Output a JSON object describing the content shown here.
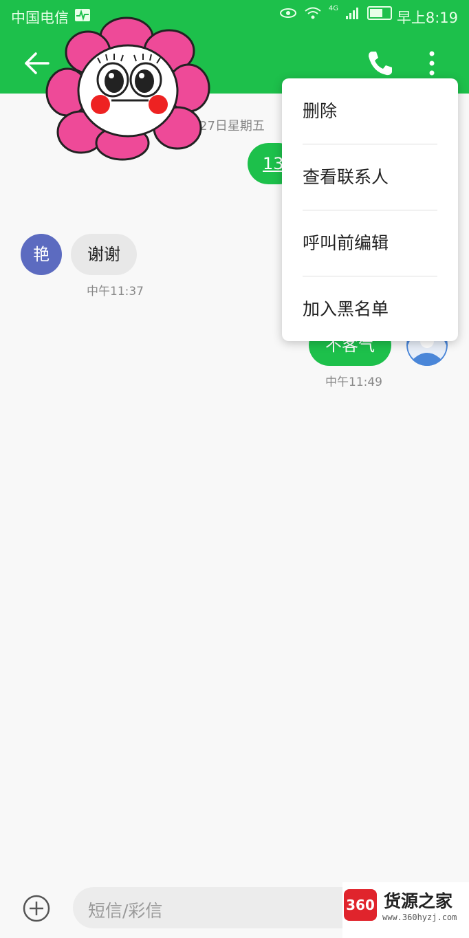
{
  "status_bar": {
    "carrier": "中国电信",
    "network": "4G",
    "time": "早上8:19"
  },
  "app_bar": {
    "back_icon": "arrow-left",
    "call_icon": "phone",
    "more_icon": "more-vertical"
  },
  "conversation": {
    "date_separator": "月27日星期五",
    "messages": [
      {
        "direction": "outgoing",
        "text": "13"
      },
      {
        "direction": "incoming",
        "sender_initial": "艳",
        "text": "谢谢",
        "time": "中午11:37"
      },
      {
        "direction": "outgoing",
        "text": "不客气",
        "time": "中午11:49"
      }
    ]
  },
  "overflow_menu": {
    "items": [
      "删除",
      "查看联系人",
      "呼叫前编辑",
      "加入黑名单"
    ]
  },
  "composer": {
    "add_icon": "plus-circle",
    "placeholder": "短信/彩信"
  },
  "watermark": {
    "logo_text": "360",
    "name": "货源之家",
    "url": "www.360hyzj.com"
  },
  "colors": {
    "accent": "#1dc04b",
    "incoming_avatar": "#5c6bc0",
    "incoming_bubble": "#e8e8e8",
    "sticker_petal": "#ee4a98",
    "sticker_cheek": "#ee2222"
  }
}
